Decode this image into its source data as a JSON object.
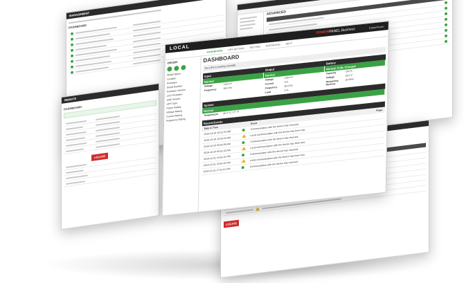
{
  "main": {
    "brand_local": "LOCAL",
    "brand_power": "POWER",
    "brand_panel": "PANEL",
    "brand_business": "Business",
    "brand_vendor": "CyberPower",
    "menu": [
      "DASHBOARD",
      "UPS SETTING",
      "SETTING",
      "REPORTING",
      "HELP"
    ],
    "sidebar_title": "OR1500",
    "sidebar_items": [
      "Model Name",
      "Location",
      "Firmware",
      "Serial Number",
      "Firmware Version",
      "LCD Firmware",
      "USB Version",
      "UPS Type",
      "Power Rating",
      "Voltage Rating",
      "Current Rating",
      "Frequency Rating"
    ],
    "page_title": "DASHBOARD",
    "status_text": "The UPS is working normally.",
    "panels": {
      "input": "Input",
      "output": "Output",
      "battery": "Battery"
    },
    "panel_status": {
      "input": "Normal",
      "output": "Normal",
      "battery": "Normal, Fully Charged"
    },
    "input_fields": [
      {
        "k": "Voltage",
        "v": "120.0 V"
      },
      {
        "k": "Frequency",
        "v": "60.0 Hz"
      }
    ],
    "output_fields": [
      {
        "k": "Voltage",
        "v": "120.0 V"
      },
      {
        "k": "Current",
        "v": "0 A"
      },
      {
        "k": "Frequency",
        "v": "60.0 Hz"
      },
      {
        "k": "Load",
        "v": "0 %"
      }
    ],
    "battery_fields": [
      {
        "k": "Capacity",
        "v": "100 %"
      },
      {
        "k": "Voltage",
        "v": "24.0 V"
      },
      {
        "k": "Remaining Runtime",
        "v": "2h 0min"
      }
    ],
    "system_label": "System",
    "system_status": "Normal",
    "temperature_label": "Temperature",
    "temperature_value": "25.0 °C / 77 °F",
    "events_title": "Recent Events",
    "events_col_date": "Date & Time",
    "events_col_event": "Event",
    "page_label": "Page:",
    "events": [
      {
        "t": "2018-12-24 16:21:03 AM",
        "e": "Communication with the device has returned.",
        "w": false
      },
      {
        "t": "2018-12-24 16:20:20 AM",
        "e": "Local communication with the device has been lost.",
        "w": true
      },
      {
        "t": "2018-12-24 05:52:56 AM",
        "e": "Communication with the device has returned.",
        "w": false
      },
      {
        "t": "2018-12-24 05:51:43 AM",
        "e": "Local communication with the device has been lost.",
        "w": true
      },
      {
        "t": "2018-12-21 19:51:23 PM",
        "e": "Communication with the device has returned.",
        "w": false
      },
      {
        "t": "2018-12-21 19:50:10 PM",
        "e": "Local communication with the device has been lost.",
        "w": true
      },
      {
        "t": "2018-12-21 17:41:01 PM",
        "e": "Communication with the device has returned.",
        "w": false
      }
    ]
  },
  "management": {
    "title": "MANAGEMENT",
    "subtitle": "DASHBOARD"
  },
  "advanced": {
    "title": "ADVANCED"
  },
  "remote": {
    "title": "REMOTE",
    "subtitle": "DASHBOARD",
    "button": "LOCATE"
  },
  "bottom": {
    "button": "LOCATE"
  },
  "colors": {
    "green": "#3aa244",
    "dark": "#2b2b2b",
    "red": "#d12b2b",
    "warning": "#f0b400"
  }
}
